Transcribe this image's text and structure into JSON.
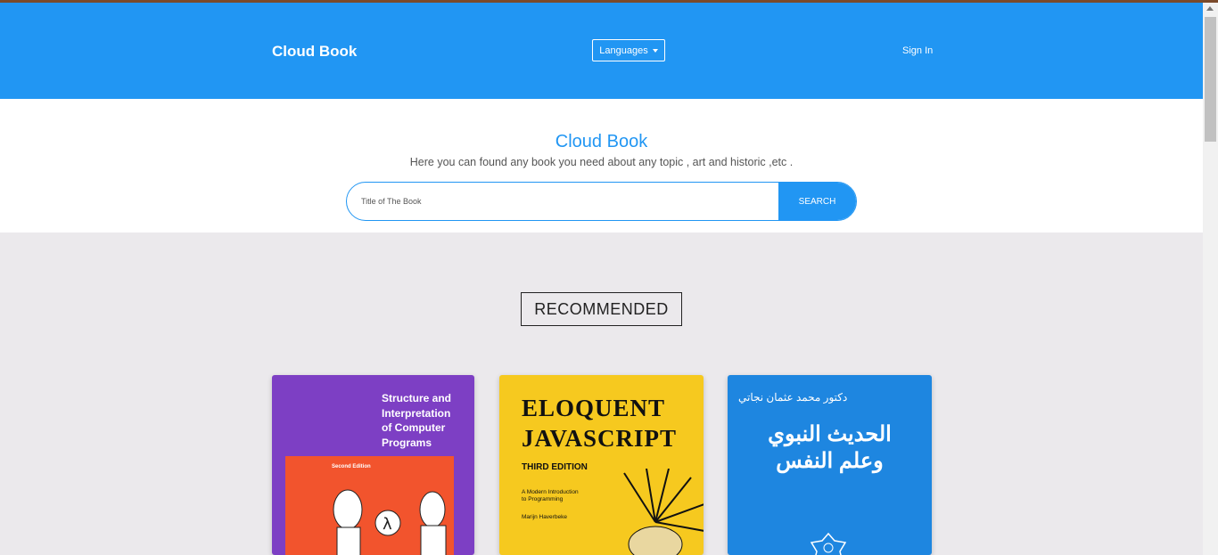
{
  "header": {
    "brand": "Cloud Book",
    "languages_label": "Languages",
    "signin_label": "Sign In"
  },
  "hero": {
    "title": "Cloud Book",
    "subtitle": "Here you can found any book you need about any topic , art and historic ,etc .",
    "search_placeholder": "Title of The Book",
    "search_button": "SEARCH"
  },
  "recommended": {
    "title": "RECOMMENDED",
    "books": [
      {
        "title_lines": [
          "Structure and",
          "Interpretation",
          "of Computer",
          "Programs"
        ],
        "edition": "Second Edition"
      },
      {
        "title_lines": [
          "ELOQUENT",
          "JAVASCRIPT"
        ],
        "edition": "THIRD EDITION",
        "subtitle_lines": [
          "A Modern Introduction",
          "to Programming"
        ],
        "author": "Marijn Haverbeke"
      },
      {
        "author": "دكتور محمد عثمان نجاتي",
        "title_lines": [
          "الحديث النبوي",
          "وعلم النفس"
        ]
      }
    ]
  },
  "colors": {
    "primary": "#2196f3",
    "page_bg": "#ebe9ec"
  },
  "icons": {
    "dropdown": "caret-down-icon"
  }
}
